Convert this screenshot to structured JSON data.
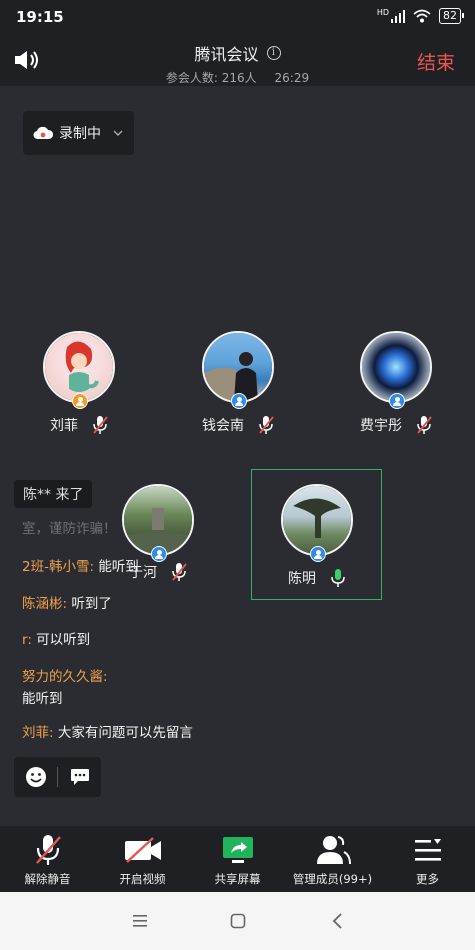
{
  "status_bar": {
    "time": "19:15",
    "network": "HD",
    "battery": "82"
  },
  "header": {
    "title": "腾讯会议",
    "participants_label": "参会人数: 216人",
    "duration": "26:29",
    "end_label": "结束"
  },
  "recording": {
    "label": "录制中"
  },
  "participants": [
    {
      "name": "刘菲",
      "mic": "muted",
      "badge": "host"
    },
    {
      "name": "钱会南",
      "mic": "muted",
      "badge": "member"
    },
    {
      "name": "费宇彤",
      "mic": "muted",
      "badge": "member"
    },
    {
      "name": "于河",
      "mic": "muted",
      "badge": "member"
    },
    {
      "name": "陈明",
      "mic": "active",
      "badge": "member"
    }
  ],
  "join_toast": "陈**  来了",
  "chat": {
    "partial": "室，谨防诈骗！",
    "messages": [
      {
        "name": "2班-韩小雪:",
        "text": "能听到"
      },
      {
        "name": "陈涵彬:",
        "text": "听到了"
      },
      {
        "name": "r:",
        "text": "可以听到"
      },
      {
        "name": "努力的久久酱:",
        "text": "能听到"
      },
      {
        "name": "刘菲:",
        "text": "大家有问题可以先留言"
      }
    ]
  },
  "toolbar": {
    "unmute": "解除静音",
    "video": "开启视频",
    "share": "共享屏幕",
    "members": "管理成员(99+)",
    "more": "更多"
  },
  "colors": {
    "accent_green": "#2fb36a",
    "end_red": "#e8564d",
    "chat_name": "#f0a04b",
    "share_green": "#22b45d"
  }
}
